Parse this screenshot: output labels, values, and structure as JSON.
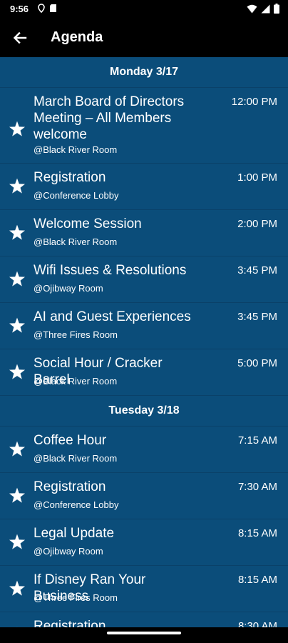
{
  "status_bar": {
    "time": "9:56"
  },
  "app_bar": {
    "title": "Agenda"
  },
  "days": [
    {
      "label": "Monday 3/17",
      "events": [
        {
          "title": "March Board of Directors Meeting – All Members welcome",
          "location": "@Black River Room",
          "time": "12:00 PM"
        },
        {
          "title": "Registration",
          "location": "@Conference Lobby",
          "time": "1:00 PM"
        },
        {
          "title": "Welcome Session",
          "location": "@Black River Room",
          "time": "2:00 PM"
        },
        {
          "title": "Wifi Issues & Resolutions",
          "location": "@Ojibway Room",
          "time": "3:45 PM"
        },
        {
          "title": "AI and Guest Experiences",
          "location": "@Three Fires Room",
          "time": "3:45 PM"
        },
        {
          "title": "Social Hour / Cracker Barrel",
          "location": "@Black River Room",
          "time": "5:00 PM"
        }
      ]
    },
    {
      "label": "Tuesday 3/18",
      "events": [
        {
          "title": "Coffee Hour",
          "location": "@Black River Room",
          "time": "7:15 AM"
        },
        {
          "title": "Registration",
          "location": "@Conference Lobby",
          "time": "7:30 AM"
        },
        {
          "title": "Legal Update",
          "location": "@Ojibway Room",
          "time": "8:15 AM"
        },
        {
          "title": "If Disney Ran Your Business",
          "location": "@Three Fires Room",
          "time": "8:15 AM"
        },
        {
          "title": "Registration",
          "location": "",
          "time": "8:30 AM"
        }
      ]
    }
  ],
  "colors": {
    "background": "#0b4d7a",
    "bar": "#000000",
    "text": "#ffffff"
  },
  "icons": {
    "back": "arrow-left-icon",
    "favorite": "star-icon"
  }
}
